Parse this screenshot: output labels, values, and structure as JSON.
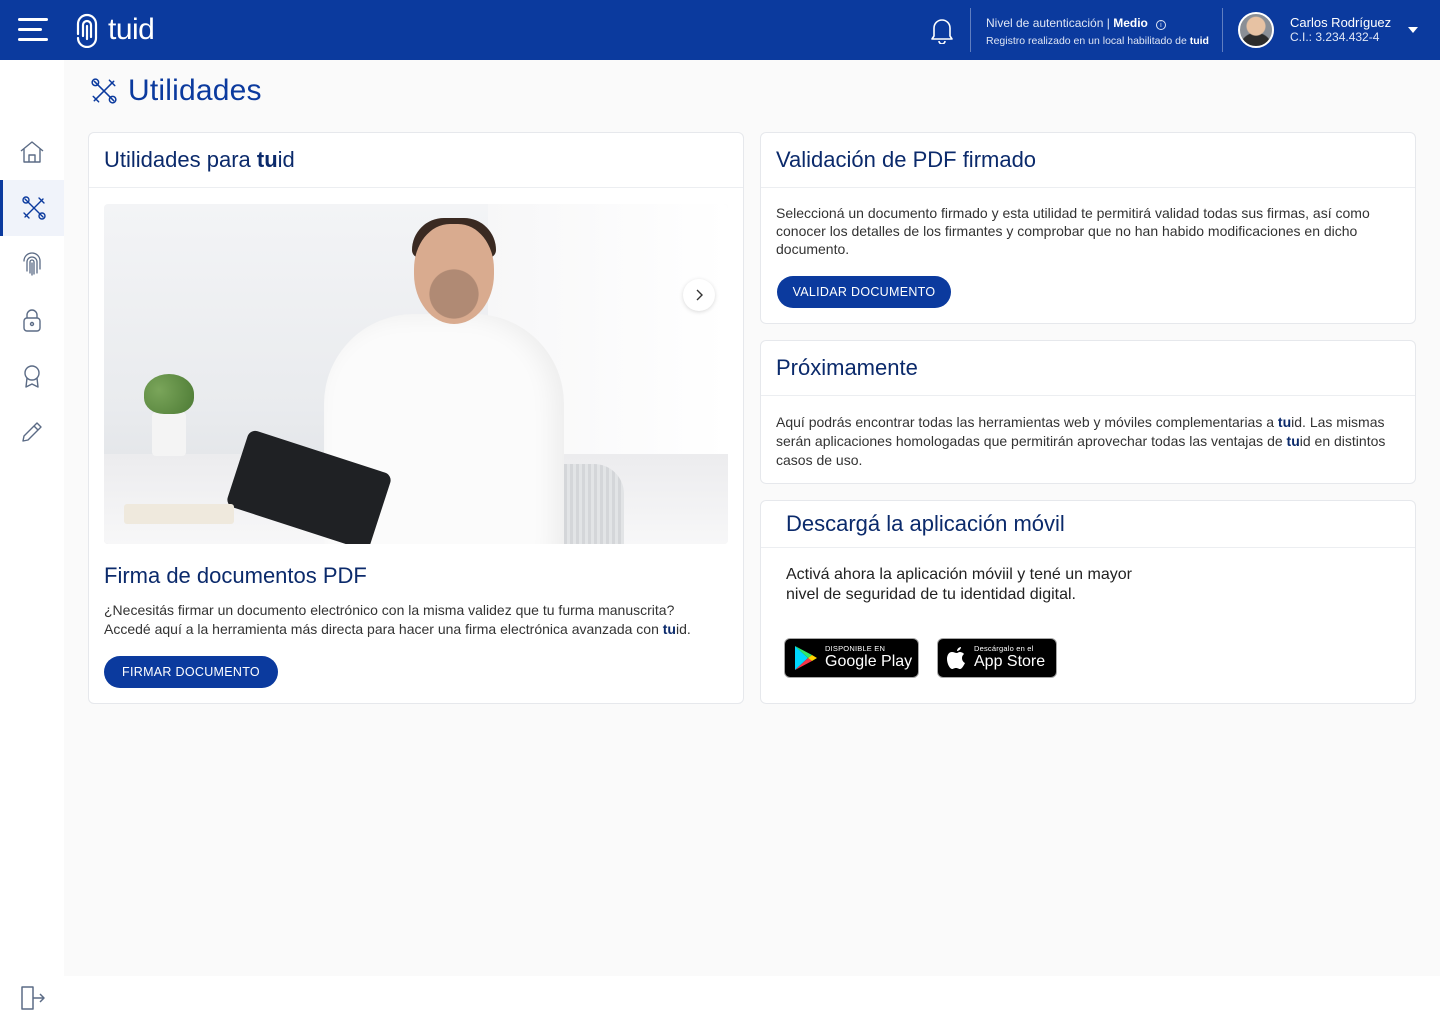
{
  "header": {
    "brand": "tuid",
    "auth_label": "Nivel de autenticación | ",
    "auth_level": "Medio",
    "registro_prefix": "Registro realizado en un local habilitado de ",
    "registro_brand": "tuid",
    "user_name": "Carlos Rodríguez",
    "user_ci": "C.I.: 3.234.432-4",
    "accent": "#0b3a9e"
  },
  "sidebar": {
    "items": [
      {
        "icon": "home-icon",
        "active": false
      },
      {
        "icon": "tools-icon",
        "active": true
      },
      {
        "icon": "fingerprint-icon",
        "active": false
      },
      {
        "icon": "lock-icon",
        "active": false
      },
      {
        "icon": "badge-icon",
        "active": false
      },
      {
        "icon": "pen-icon",
        "active": false
      }
    ],
    "logout_icon": "logout-icon"
  },
  "page": {
    "title": "Utilidades"
  },
  "utilidades_card": {
    "title_prefix": "Utilidades para ",
    "title_brand_bold": "tu",
    "title_brand_rest": "id",
    "feature_title": "Firma de documentos PDF",
    "feature_line1": "¿Necesitás firmar un documento electrónico con la misma validez que tu furma manuscrita?",
    "feature_line2_prefix": "Accedé aquí a la herramienta más directa para hacer una firma electrónica avanzada con ",
    "feature_line2_brand_bold": "tu",
    "feature_line2_brand_rest": "id",
    "feature_line2_suffix": ".",
    "button": "FIRMAR DOCUMENTO"
  },
  "validacion_card": {
    "title": "Validación de PDF firmado",
    "body": "Seleccioná un documento firmado y esta utilidad te permitirá validad todas sus firmas, así como conocer los detalles de los firmantes y comprobar que no han habido modificaciones en dicho documento.",
    "button": "VALIDAR DOCUMENTO"
  },
  "proximamente_card": {
    "title": "Próximamente",
    "body_part1": "Aquí podrás encontrar todas las herramientas web y móviles complementarias a ",
    "brand1_bold": "tu",
    "brand1_rest": "id",
    "body_part2": ". Las mismas serán aplicaciones homologadas que permitirán aprovechar todas las ventajas de ",
    "brand2_bold": "tu",
    "brand2_rest": "id",
    "body_part3": " en distintos casos de uso."
  },
  "app_card": {
    "title": "Descargá la aplicación móvil",
    "body_line1": "Activá ahora la aplicación móviil y tené un mayor",
    "body_line2": "nivel de seguridad de tu identidad digital.",
    "google_small": "DISPONIBLE EN",
    "google_big": "Google Play",
    "apple_small": "Descárgalo en el",
    "apple_big": "App Store"
  }
}
